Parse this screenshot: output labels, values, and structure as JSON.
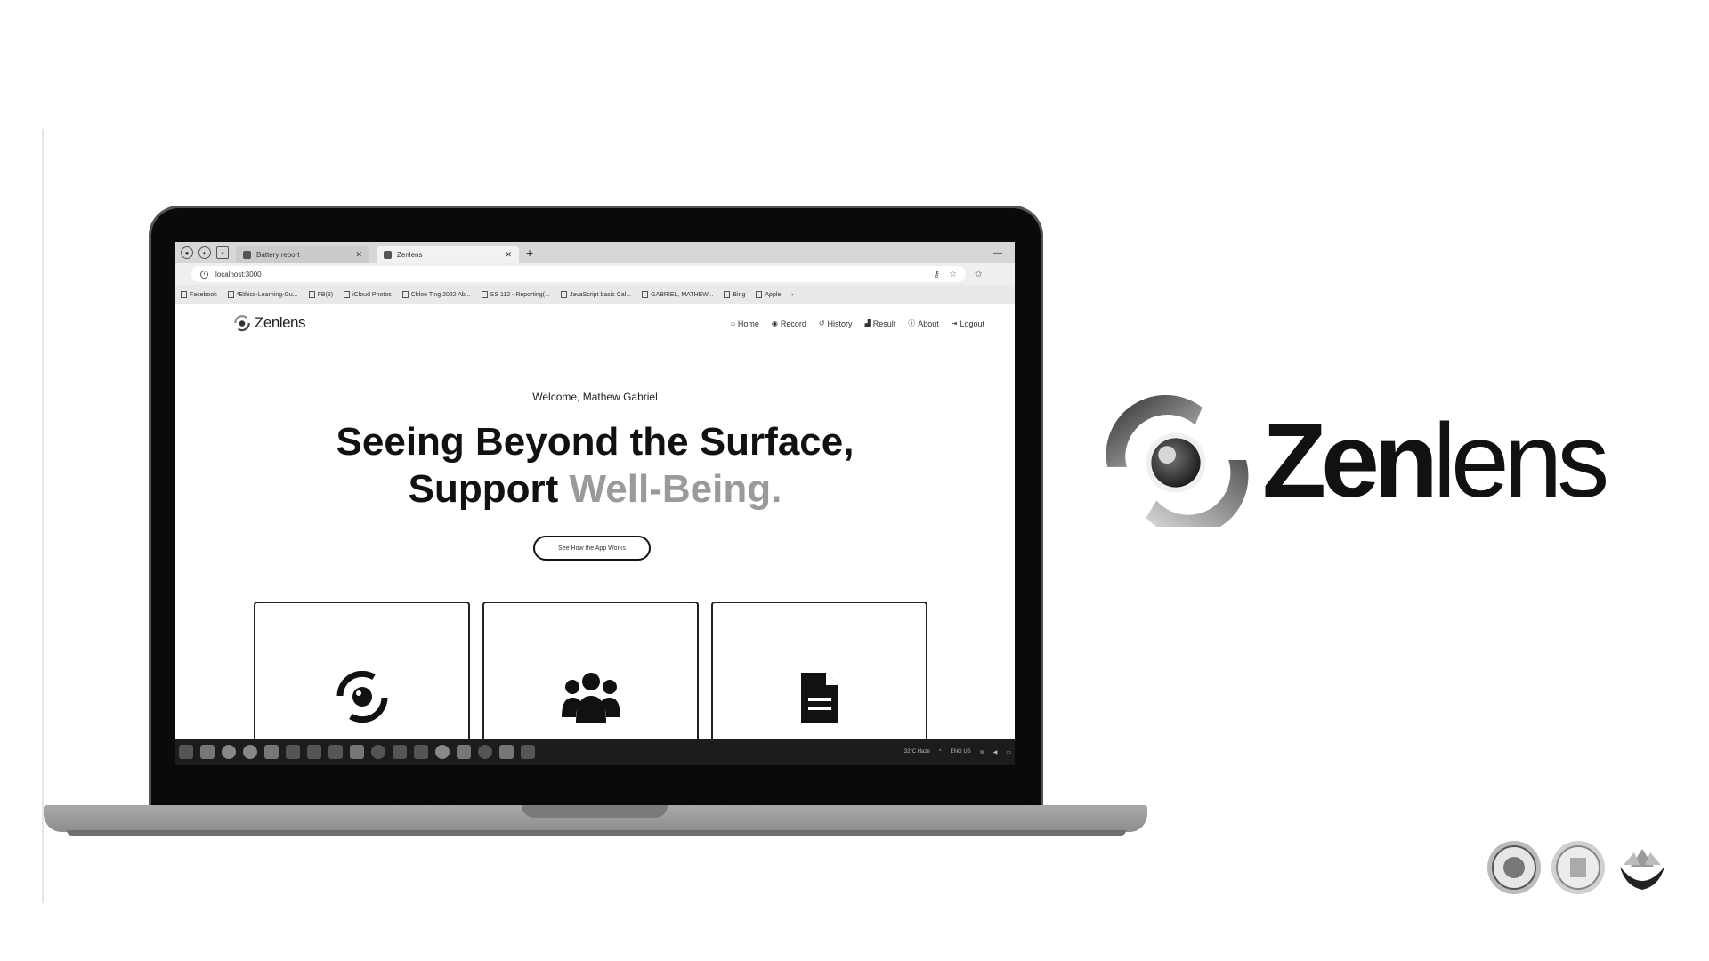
{
  "browser": {
    "tabs": [
      {
        "label": "Battery report",
        "active": false
      },
      {
        "label": "Zenlens",
        "active": true
      }
    ],
    "url": "localhost:3000",
    "bookmarks": [
      "Facebook",
      "*Ethics-Learning-Gu...",
      "FB(3)",
      "iCloud Photos",
      "Chloe Ting 2022 Ab...",
      "SS 112 - Reporting(...",
      "JavaScript basic Cal...",
      "GABRIEL, MATHEW...",
      "Bing",
      "Apple"
    ]
  },
  "app": {
    "brand": "Zenlens",
    "nav": [
      {
        "label": "Home",
        "icon": "home-icon"
      },
      {
        "label": "Record",
        "icon": "record-icon"
      },
      {
        "label": "History",
        "icon": "history-icon"
      },
      {
        "label": "Result",
        "icon": "chart-icon"
      },
      {
        "label": "About",
        "icon": "info-icon"
      },
      {
        "label": "Logout",
        "icon": "logout-icon"
      }
    ],
    "welcome": "Welcome, Mathew Gabriel",
    "hero_line1": "Seeing Beyond the Surface,",
    "hero_line2_a": "Support",
    "hero_line2_b": "Well-Being.",
    "cta": "See How the App Works",
    "cards": [
      {
        "icon": "eye-icon"
      },
      {
        "icon": "users-icon"
      },
      {
        "icon": "document-icon"
      }
    ]
  },
  "taskbar": {
    "weather": "32°C Haze",
    "lang": "ENG US"
  },
  "brand_logo": {
    "part1": "Zen",
    "part2": "lens"
  },
  "colors": {
    "hero_accent": "#9a9a9a",
    "laptop_frame": "#0a0a0a"
  }
}
